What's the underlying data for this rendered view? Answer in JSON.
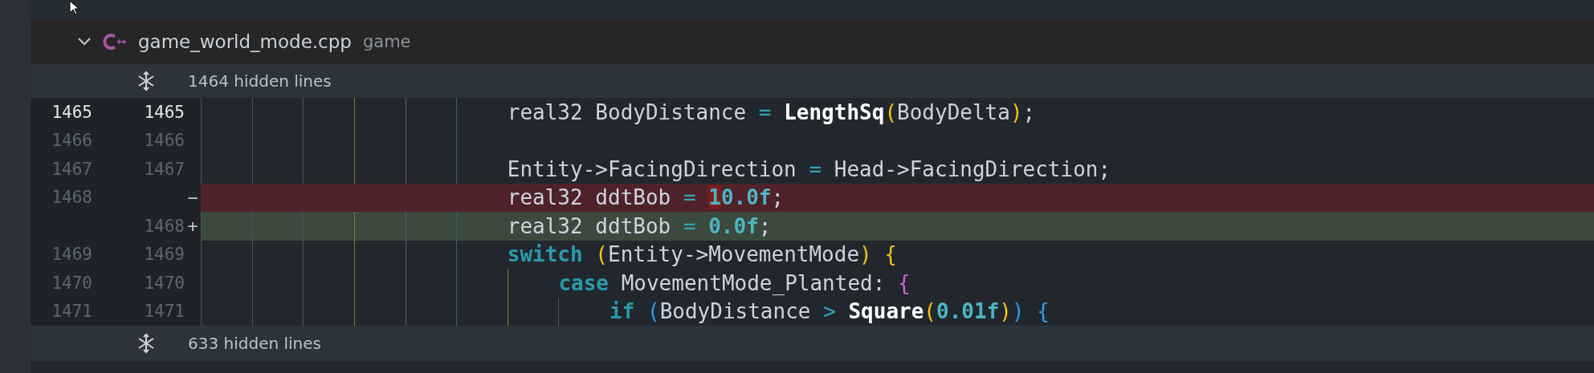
{
  "file_header": {
    "expanded": true,
    "file_name": "game_world_mode.cpp",
    "folder": "game"
  },
  "hidden_before": {
    "label": "1464 hidden lines"
  },
  "lines": [
    {
      "kind": "context",
      "active": true,
      "old": "1465",
      "new": "1465",
      "tokens": [
        {
          "kind": "plain",
          "text": "                        real32 BodyDistance "
        },
        {
          "kind": "op",
          "text": "= "
        },
        {
          "kind": "func",
          "text": "LengthSq"
        },
        {
          "kind": "bracket1",
          "text": "("
        },
        {
          "kind": "plain",
          "text": "BodyDelta"
        },
        {
          "kind": "bracket1",
          "text": ")"
        },
        {
          "kind": "plain",
          "text": ";"
        }
      ]
    },
    {
      "kind": "context",
      "active": false,
      "old": "1466",
      "new": "1466"
    },
    {
      "kind": "context",
      "active": false,
      "old": "1467",
      "new": "1467",
      "tokens": [
        {
          "kind": "plain",
          "text": "                        Entity->FacingDirection "
        },
        {
          "kind": "op",
          "text": "="
        },
        {
          "kind": "plain",
          "text": " Head->FacingDirection;"
        }
      ]
    },
    {
      "kind": "removed",
      "active": false,
      "old": "1468",
      "sign": "−",
      "tokens": [
        {
          "kind": "plain",
          "text": "                        real32 ddtBob "
        },
        {
          "kind": "op",
          "text": "= "
        },
        {
          "kind": "number",
          "text": "1",
          "changed": true
        },
        {
          "kind": "number",
          "text": "0.0f"
        },
        {
          "kind": "plain",
          "text": ";"
        }
      ]
    },
    {
      "kind": "added",
      "active": false,
      "new": "1468",
      "sign": "+",
      "tokens": [
        {
          "kind": "plain",
          "text": "                        real32 ddtBob "
        },
        {
          "kind": "op",
          "text": "= "
        },
        {
          "kind": "number",
          "text": "0.0f"
        },
        {
          "kind": "plain",
          "text": ";"
        }
      ]
    },
    {
      "kind": "context",
      "active": false,
      "old": "1469",
      "new": "1469",
      "tokens": [
        {
          "kind": "keyword",
          "text": "                        switch "
        },
        {
          "kind": "bracket1",
          "text": "("
        },
        {
          "kind": "plain",
          "text": "Entity->MovementMode"
        },
        {
          "kind": "bracket1",
          "text": ") {"
        }
      ]
    },
    {
      "kind": "context",
      "active": false,
      "old": "1470",
      "new": "1470",
      "tokens": [
        {
          "kind": "keyword",
          "text": "                            case"
        },
        {
          "kind": "plain",
          "text": " MovementMode_Planted: "
        },
        {
          "kind": "bracket2",
          "text": "{"
        }
      ]
    },
    {
      "kind": "context",
      "active": false,
      "old": "1471",
      "new": "1471",
      "tokens": [
        {
          "kind": "keyword",
          "text": "                                if "
        },
        {
          "kind": "bracket3",
          "text": "("
        },
        {
          "kind": "plain",
          "text": "BodyDistance "
        },
        {
          "kind": "op",
          "text": "> "
        },
        {
          "kind": "func",
          "text": "Square"
        },
        {
          "kind": "bracket1",
          "text": "("
        },
        {
          "kind": "number",
          "text": "0.01f"
        },
        {
          "kind": "bracket1",
          "text": ")"
        },
        {
          "kind": "bracket3",
          "text": ") {"
        }
      ]
    }
  ],
  "hidden_after": {
    "label": "633 hidden lines"
  }
}
